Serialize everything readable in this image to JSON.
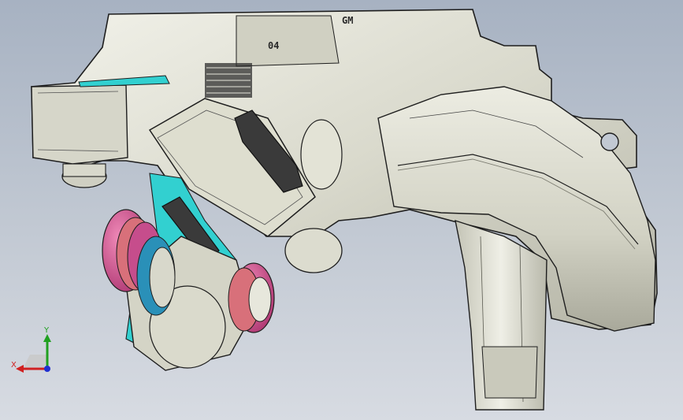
{
  "viewport": {
    "background_top": "#a7b2c2",
    "background_bottom": "#d7dbe2"
  },
  "model": {
    "body_color": "#dcdcd0",
    "edge_color": "#1e1e1e",
    "section_color": "#32d0d0",
    "bushing_colors": [
      "#c64d8c",
      "#d8707a",
      "#2a90b8"
    ],
    "bearing_ring_color": "#3a3a3a",
    "engraved_text": {
      "logo": "GM",
      "part_mark": "04"
    }
  },
  "triad": {
    "x_label": "X",
    "y_label": "Y",
    "x_color": "#d02020",
    "y_color": "#20a020",
    "z_color": "#2030d0"
  }
}
